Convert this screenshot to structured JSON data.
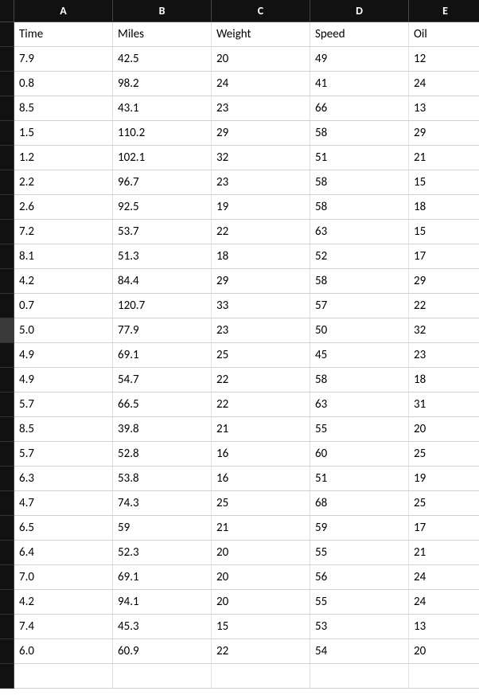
{
  "columns": [
    "A",
    "B",
    "C",
    "D",
    "E"
  ],
  "row_headers": [
    "",
    "",
    "",
    "",
    "",
    "",
    "",
    "",
    "",
    "",
    "",
    "",
    "",
    "",
    "",
    "",
    "",
    "",
    "",
    "",
    "",
    "",
    "",
    "",
    "",
    "",
    "",
    ""
  ],
  "selected_row_index": 12,
  "headers": [
    "Time",
    "Miles",
    "Weight",
    "Speed",
    "Oil"
  ],
  "rows": [
    [
      "7.9",
      "42.5",
      "20",
      "49",
      "12"
    ],
    [
      "0.8",
      "98.2",
      "24",
      "41",
      "24"
    ],
    [
      "8.5",
      "43.1",
      "23",
      "66",
      "13"
    ],
    [
      "1.5",
      "110.2",
      "29",
      "58",
      "29"
    ],
    [
      "1.2",
      "102.1",
      "32",
      "51",
      "21"
    ],
    [
      "2.2",
      "96.7",
      "23",
      "58",
      "15"
    ],
    [
      "2.6",
      "92.5",
      "19",
      "58",
      "18"
    ],
    [
      "7.2",
      "53.7",
      "22",
      "63",
      "15"
    ],
    [
      "8.1",
      "51.3",
      "18",
      "52",
      "17"
    ],
    [
      "4.2",
      "84.4",
      "29",
      "58",
      "29"
    ],
    [
      "0.7",
      "120.7",
      "33",
      "57",
      "22"
    ],
    [
      "5.0",
      "77.9",
      "23",
      "50",
      "32"
    ],
    [
      "4.9",
      "69.1",
      "25",
      "45",
      "23"
    ],
    [
      "4.9",
      "54.7",
      "22",
      "58",
      "18"
    ],
    [
      "5.7",
      "66.5",
      "22",
      "63",
      "31"
    ],
    [
      "8.5",
      "39.8",
      "21",
      "55",
      "20"
    ],
    [
      "5.7",
      "52.8",
      "16",
      "60",
      "25"
    ],
    [
      "6.3",
      "53.8",
      "16",
      "51",
      "19"
    ],
    [
      "4.7",
      "74.3",
      "25",
      "68",
      "25"
    ],
    [
      "6.5",
      "59",
      "21",
      "59",
      "17"
    ],
    [
      "6.4",
      "52.3",
      "20",
      "55",
      "21"
    ],
    [
      "7.0",
      "69.1",
      "20",
      "56",
      "24"
    ],
    [
      "4.2",
      "94.1",
      "20",
      "55",
      "24"
    ],
    [
      "7.4",
      "45.3",
      "15",
      "53",
      "13"
    ],
    [
      "6.0",
      "60.9",
      "22",
      "54",
      "20"
    ]
  ],
  "chart_data": {
    "type": "table",
    "columns": [
      "Time",
      "Miles",
      "Weight",
      "Speed",
      "Oil"
    ],
    "data": [
      [
        7.9,
        42.5,
        20,
        49,
        12
      ],
      [
        0.8,
        98.2,
        24,
        41,
        24
      ],
      [
        8.5,
        43.1,
        23,
        66,
        13
      ],
      [
        1.5,
        110.2,
        29,
        58,
        29
      ],
      [
        1.2,
        102.1,
        32,
        51,
        21
      ],
      [
        2.2,
        96.7,
        23,
        58,
        15
      ],
      [
        2.6,
        92.5,
        19,
        58,
        18
      ],
      [
        7.2,
        53.7,
        22,
        63,
        15
      ],
      [
        8.1,
        51.3,
        18,
        52,
        17
      ],
      [
        4.2,
        84.4,
        29,
        58,
        29
      ],
      [
        0.7,
        120.7,
        33,
        57,
        22
      ],
      [
        5.0,
        77.9,
        23,
        50,
        32
      ],
      [
        4.9,
        69.1,
        25,
        45,
        23
      ],
      [
        4.9,
        54.7,
        22,
        58,
        18
      ],
      [
        5.7,
        66.5,
        22,
        63,
        31
      ],
      [
        8.5,
        39.8,
        21,
        55,
        20
      ],
      [
        5.7,
        52.8,
        16,
        60,
        25
      ],
      [
        6.3,
        53.8,
        16,
        51,
        19
      ],
      [
        4.7,
        74.3,
        25,
        68,
        25
      ],
      [
        6.5,
        59,
        21,
        59,
        17
      ],
      [
        6.4,
        52.3,
        20,
        55,
        21
      ],
      [
        7.0,
        69.1,
        20,
        56,
        24
      ],
      [
        4.2,
        94.1,
        20,
        55,
        24
      ],
      [
        7.4,
        45.3,
        15,
        53,
        13
      ],
      [
        6.0,
        60.9,
        22,
        54,
        20
      ]
    ]
  }
}
